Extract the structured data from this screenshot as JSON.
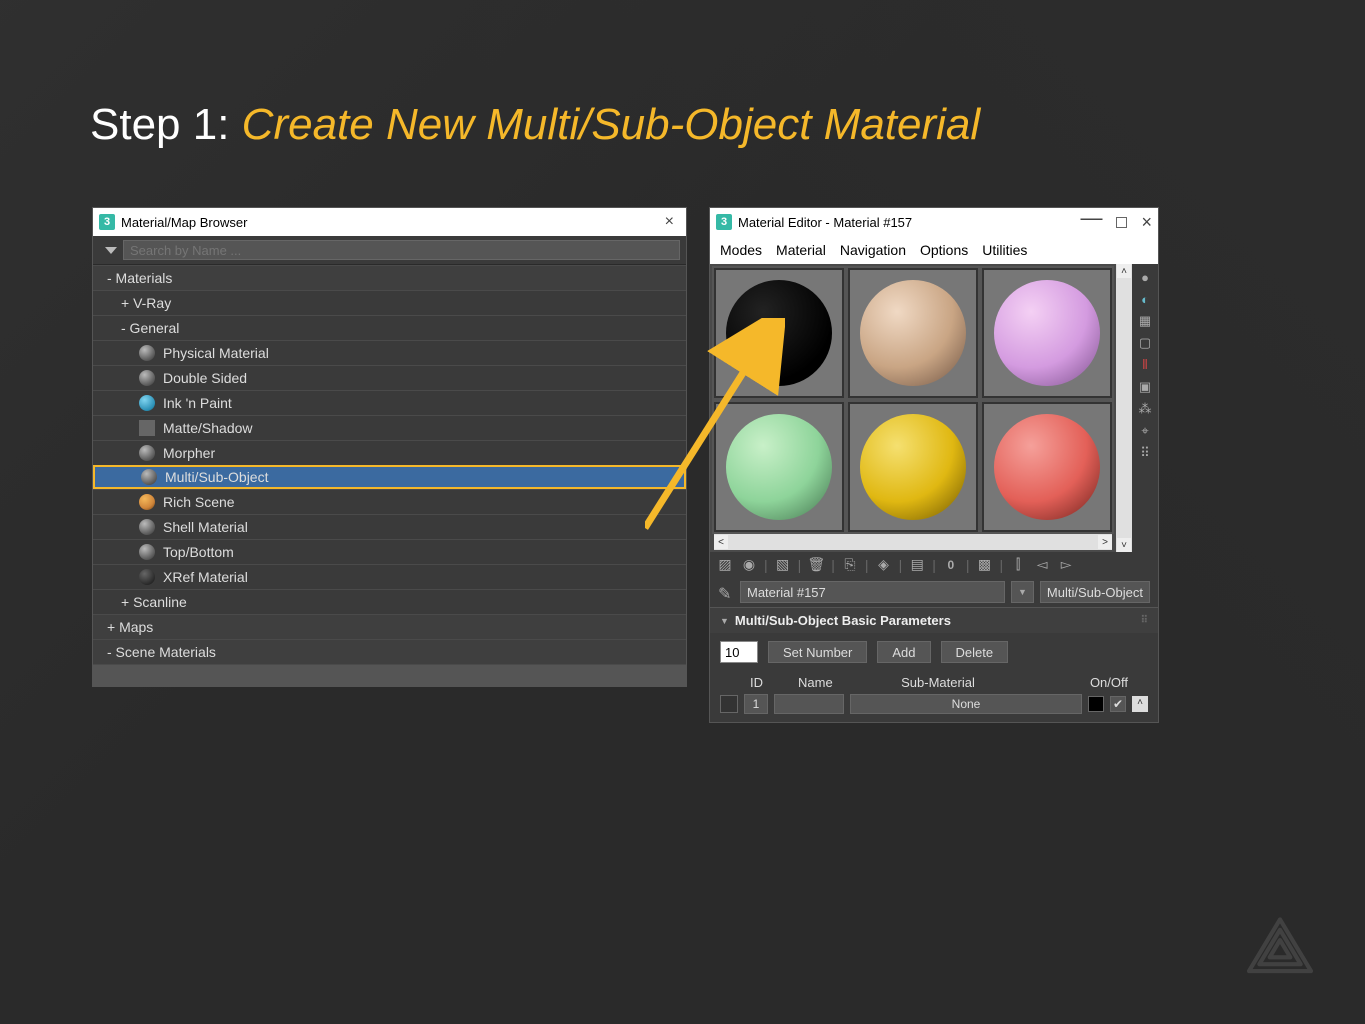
{
  "slide": {
    "step_prefix": "Step 1: ",
    "step_title": "Create New Multi/Sub-Object Material"
  },
  "browser": {
    "title": "Material/Map Browser",
    "close": "×",
    "search_placeholder": "Search by Name ...",
    "sections": {
      "materials": "- Materials",
      "vray": "+ V-Ray",
      "general": "- General",
      "maps": "+ Maps",
      "scanline": "+ Scanline",
      "scene": "- Scene Materials"
    },
    "items": [
      "Physical Material",
      "Double Sided",
      "Ink 'n Paint",
      "Matte/Shadow",
      "Morpher",
      "Multi/Sub-Object",
      "Rich Scene",
      "Shell Material",
      "Top/Bottom",
      "XRef Material"
    ]
  },
  "editor": {
    "title": "Material Editor - Material #157",
    "menu": [
      "Modes",
      "Material",
      "Navigation",
      "Options",
      "Utilities"
    ],
    "material_name": "Material #157",
    "material_type": "Multi/Sub-Object",
    "rollout_title": "Multi/Sub-Object Basic Parameters",
    "num_value": "10",
    "btn_setnum": "Set Number",
    "btn_add": "Add",
    "btn_delete": "Delete",
    "hdr_id": "ID",
    "hdr_name": "Name",
    "hdr_sub": "Sub-Material",
    "hdr_onoff": "On/Off",
    "slot1_id": "1",
    "slot1_sub": "None",
    "slot1_check": "✔"
  }
}
